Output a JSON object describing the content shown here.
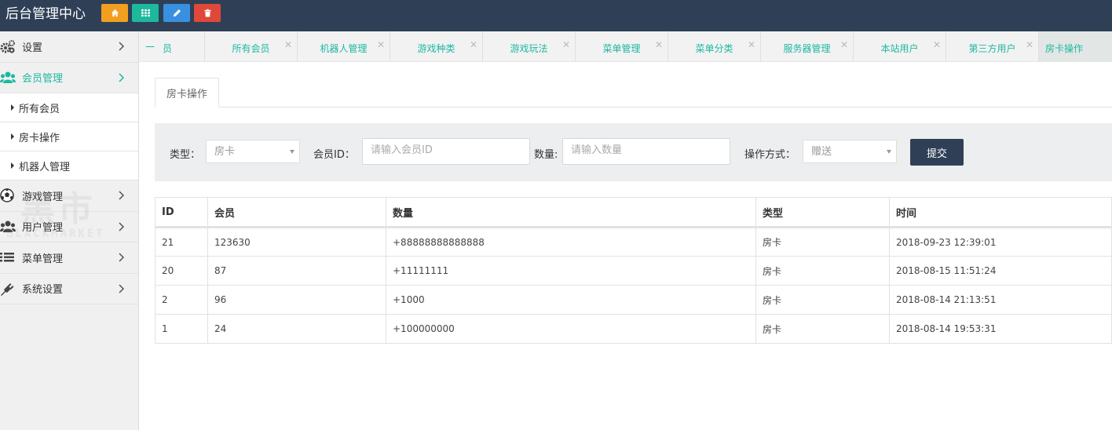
{
  "header": {
    "title": "后台管理中心",
    "buttons": [
      {
        "icon": "home-icon",
        "color": "#f0a01e"
      },
      {
        "icon": "grid-icon",
        "color": "#1eb89c"
      },
      {
        "icon": "pencil-icon",
        "color": "#3a90e0"
      },
      {
        "icon": "trash-icon",
        "color": "#e0483a"
      }
    ]
  },
  "sidebar": {
    "items": [
      {
        "label": "设置",
        "icon": "gears-icon"
      },
      {
        "label": "会员管理",
        "icon": "users-icon",
        "active": true
      },
      {
        "label": "游戏管理",
        "icon": "soccer-ball-icon"
      },
      {
        "label": "用户管理",
        "icon": "users-icon"
      },
      {
        "label": "菜单管理",
        "icon": "list-icon"
      },
      {
        "label": "系统设置",
        "icon": "plug-icon"
      }
    ],
    "subitems": [
      "所有会员",
      "房卡操作",
      "机器人管理"
    ],
    "watermark": {
      "big": "黑市",
      "small": "BLACKMARKET"
    }
  },
  "tabs": [
    {
      "label": "员",
      "prefix": "一"
    },
    {
      "label": "所有会员"
    },
    {
      "label": "机器人管理"
    },
    {
      "label": "游戏种类"
    },
    {
      "label": "游戏玩法"
    },
    {
      "label": "菜单管理"
    },
    {
      "label": "菜单分类"
    },
    {
      "label": "服务器管理"
    },
    {
      "label": "本站用户"
    },
    {
      "label": "第三方用户"
    },
    {
      "label": "房卡操作",
      "current": true
    }
  ],
  "content": {
    "sub_tab": "房卡操作",
    "form": {
      "type_label": "类型：",
      "type_value": "房卡",
      "member_label": "会员ID：",
      "member_placeholder": "请输入会员ID",
      "qty_label": "数量:",
      "qty_placeholder": "请输入数量",
      "method_label": "操作方式：",
      "method_value": "赠送",
      "submit": "提交"
    },
    "table": {
      "headers": [
        "ID",
        "会员",
        "数量",
        "类型",
        "时间"
      ],
      "rows": [
        [
          "21",
          "123630",
          "+88888888888888",
          "房卡",
          "2018-09-23 12:39:01"
        ],
        [
          "20",
          "87",
          "+11111111",
          "房卡",
          "2018-08-15 11:51:24"
        ],
        [
          "2",
          "96",
          "+1000",
          "房卡",
          "2018-08-14 21:13:51"
        ],
        [
          "1",
          "24",
          "+100000000",
          "房卡",
          "2018-08-14 19:53:31"
        ]
      ]
    }
  },
  "colors": {
    "accent": "#1eb8a0",
    "topbar": "#2f4056"
  }
}
